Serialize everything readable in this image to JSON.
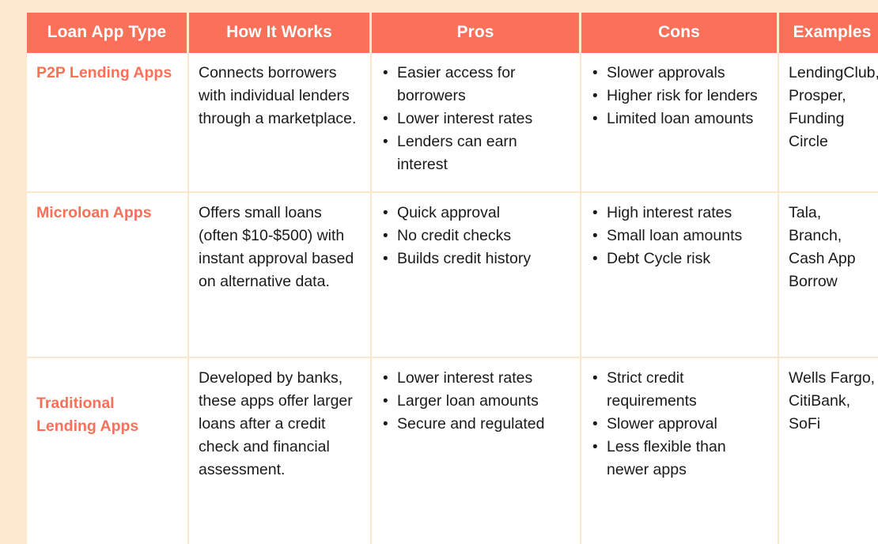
{
  "table": {
    "headers": [
      "Loan App Type",
      "How It Works",
      "Pros",
      "Cons",
      "Examples"
    ],
    "rows": [
      {
        "type": "P2P Lending Apps",
        "how_it_works": "Connects borrowers with individual lenders through a marketplace.",
        "pros": [
          "Easier access for borrowers",
          "Lower interest rates",
          "Lenders can earn interest"
        ],
        "cons": [
          "Slower approvals",
          "Higher risk for lenders",
          "Limited loan amounts"
        ],
        "examples": "LendingClub, Prosper, Funding Circle"
      },
      {
        "type": "Microloan Apps",
        "how_it_works": "Offers small loans (often $10-$500) with instant approval based on alternative data.",
        "pros": [
          "Quick approval",
          "No credit checks",
          "Builds credit history"
        ],
        "cons": [
          "High interest rates",
          "Small loan amounts",
          "Debt Cycle risk"
        ],
        "examples": "Tala, Branch, Cash App Borrow"
      },
      {
        "type": "Traditional Lending Apps",
        "how_it_works": "Developed by banks, these apps offer larger loans after a credit check and financial assessment.",
        "pros": [
          "Lower interest rates",
          "Larger loan amounts",
          "Secure and regulated"
        ],
        "cons": [
          "Strict credit requirements",
          "Slower approval",
          "Less flexible than newer apps"
        ],
        "examples": "Wells Fargo, CitiBank, SoFi"
      }
    ]
  },
  "colors": {
    "header_background": "#FA7059",
    "header_text": "#FFFFFF",
    "page_background": "#FCE9D0",
    "cell_background": "#FFFFFF",
    "type_label": "#FA7059",
    "body_text": "#1A1A1A",
    "divider": "#FAE7CE"
  }
}
